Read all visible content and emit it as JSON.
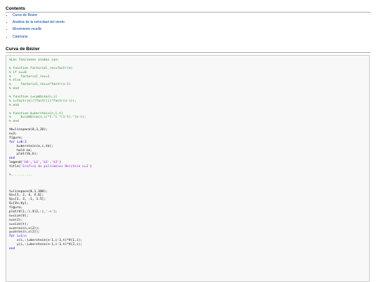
{
  "contents": {
    "heading": "Contents",
    "items": [
      "Curva de Bézier",
      "Analisis de la velocidad del viento",
      "Movimiento muelle",
      "Catenaria"
    ]
  },
  "section": {
    "heading": "Curva de Bézier"
  },
  "code_lines": [
    {
      "t": "cm",
      "s": "%Las funciones usadas son:"
    },
    {
      "t": "",
      "s": ""
    },
    {
      "t": "cm",
      "s": "% function factorial_rec=factr(n)"
    },
    {
      "t": "cm",
      "s": "% if n==0"
    },
    {
      "t": "cm",
      "s": "%     factorial_rec=1"
    },
    {
      "t": "cm",
      "s": "% else"
    },
    {
      "t": "cm",
      "s": "%     factorial_rec=n*factr(n-1)"
    },
    {
      "t": "cm",
      "s": "% end"
    },
    {
      "t": "",
      "s": ""
    },
    {
      "t": "cm",
      "s": "% function c=combina(n,i)"
    },
    {
      "t": "cm",
      "s": "% c=factr(n)/(factr(i)*factr(n-i));"
    },
    {
      "t": "cm",
      "s": "% end"
    },
    {
      "t": "",
      "s": ""
    },
    {
      "t": "cm",
      "s": "% function b=berstein(n,i,t)"
    },
    {
      "t": "cm",
      "s": "%     b=combina(n,i)*t.^i.*(1-t).^(n-i);"
    },
    {
      "t": "cm",
      "s": "% end"
    },
    {
      "t": "",
      "s": ""
    },
    {
      "t": "",
      "s": "tb=linspace(0,1,20);"
    },
    {
      "t": "",
      "s": "n=3;"
    },
    {
      "t": "",
      "s": "figure;"
    },
    {
      "t": "kw",
      "s": "for i=0:3"
    },
    {
      "t": "",
      "s": "    b=berstein(n,i,tb);"
    },
    {
      "t": "",
      "s": "    hold on;"
    },
    {
      "t": "",
      "s": "    plot(tb,b);"
    },
    {
      "t": "kw",
      "s": "end"
    },
    {
      "t": "",
      "s": "legend('b0','b1','b2','b3')"
    },
    {
      "t": "",
      "s": "title('Grafica de polinomios Berstein n=3')"
    },
    {
      "t": "",
      "s": ""
    },
    {
      "t": "cm",
      "s": "%..........."
    },
    {
      "t": "",
      "s": ""
    },
    {
      "t": "",
      "s": ""
    },
    {
      "t": "",
      "s": ""
    },
    {
      "t": "",
      "s": "t=linspace(0,1,100);"
    },
    {
      "t": "",
      "s": "Vx=[1, 2, 4, 4.6];"
    },
    {
      "t": "",
      "s": "Vy=[1, 3, -1, 1.5];"
    },
    {
      "t": "",
      "s": "V=[Vx;Vy];"
    },
    {
      "t": "",
      "s": "figure;"
    },
    {
      "t": "",
      "s": "plot(V(1,:),V(2,:),'-o');"
    },
    {
      "t": "",
      "s": "n=size(V);"
    },
    {
      "t": "",
      "s": "n=n(2);"
    },
    {
      "t": "",
      "s": "s=size(t);"
    },
    {
      "t": "",
      "s": "x=zeros(n,s(2));"
    },
    {
      "t": "",
      "s": "y=zeros(n,s(2));"
    },
    {
      "t": "kw",
      "s": "for i=1:n"
    },
    {
      "t": "",
      "s": "    x(i,:)=berstein(n-1,i-1,t)*V(1,i);"
    },
    {
      "t": "",
      "s": "    y(i,:)=berstein(n-1,i-1,t)*V(2,i);"
    },
    {
      "t": "kw",
      "s": "end"
    }
  ]
}
